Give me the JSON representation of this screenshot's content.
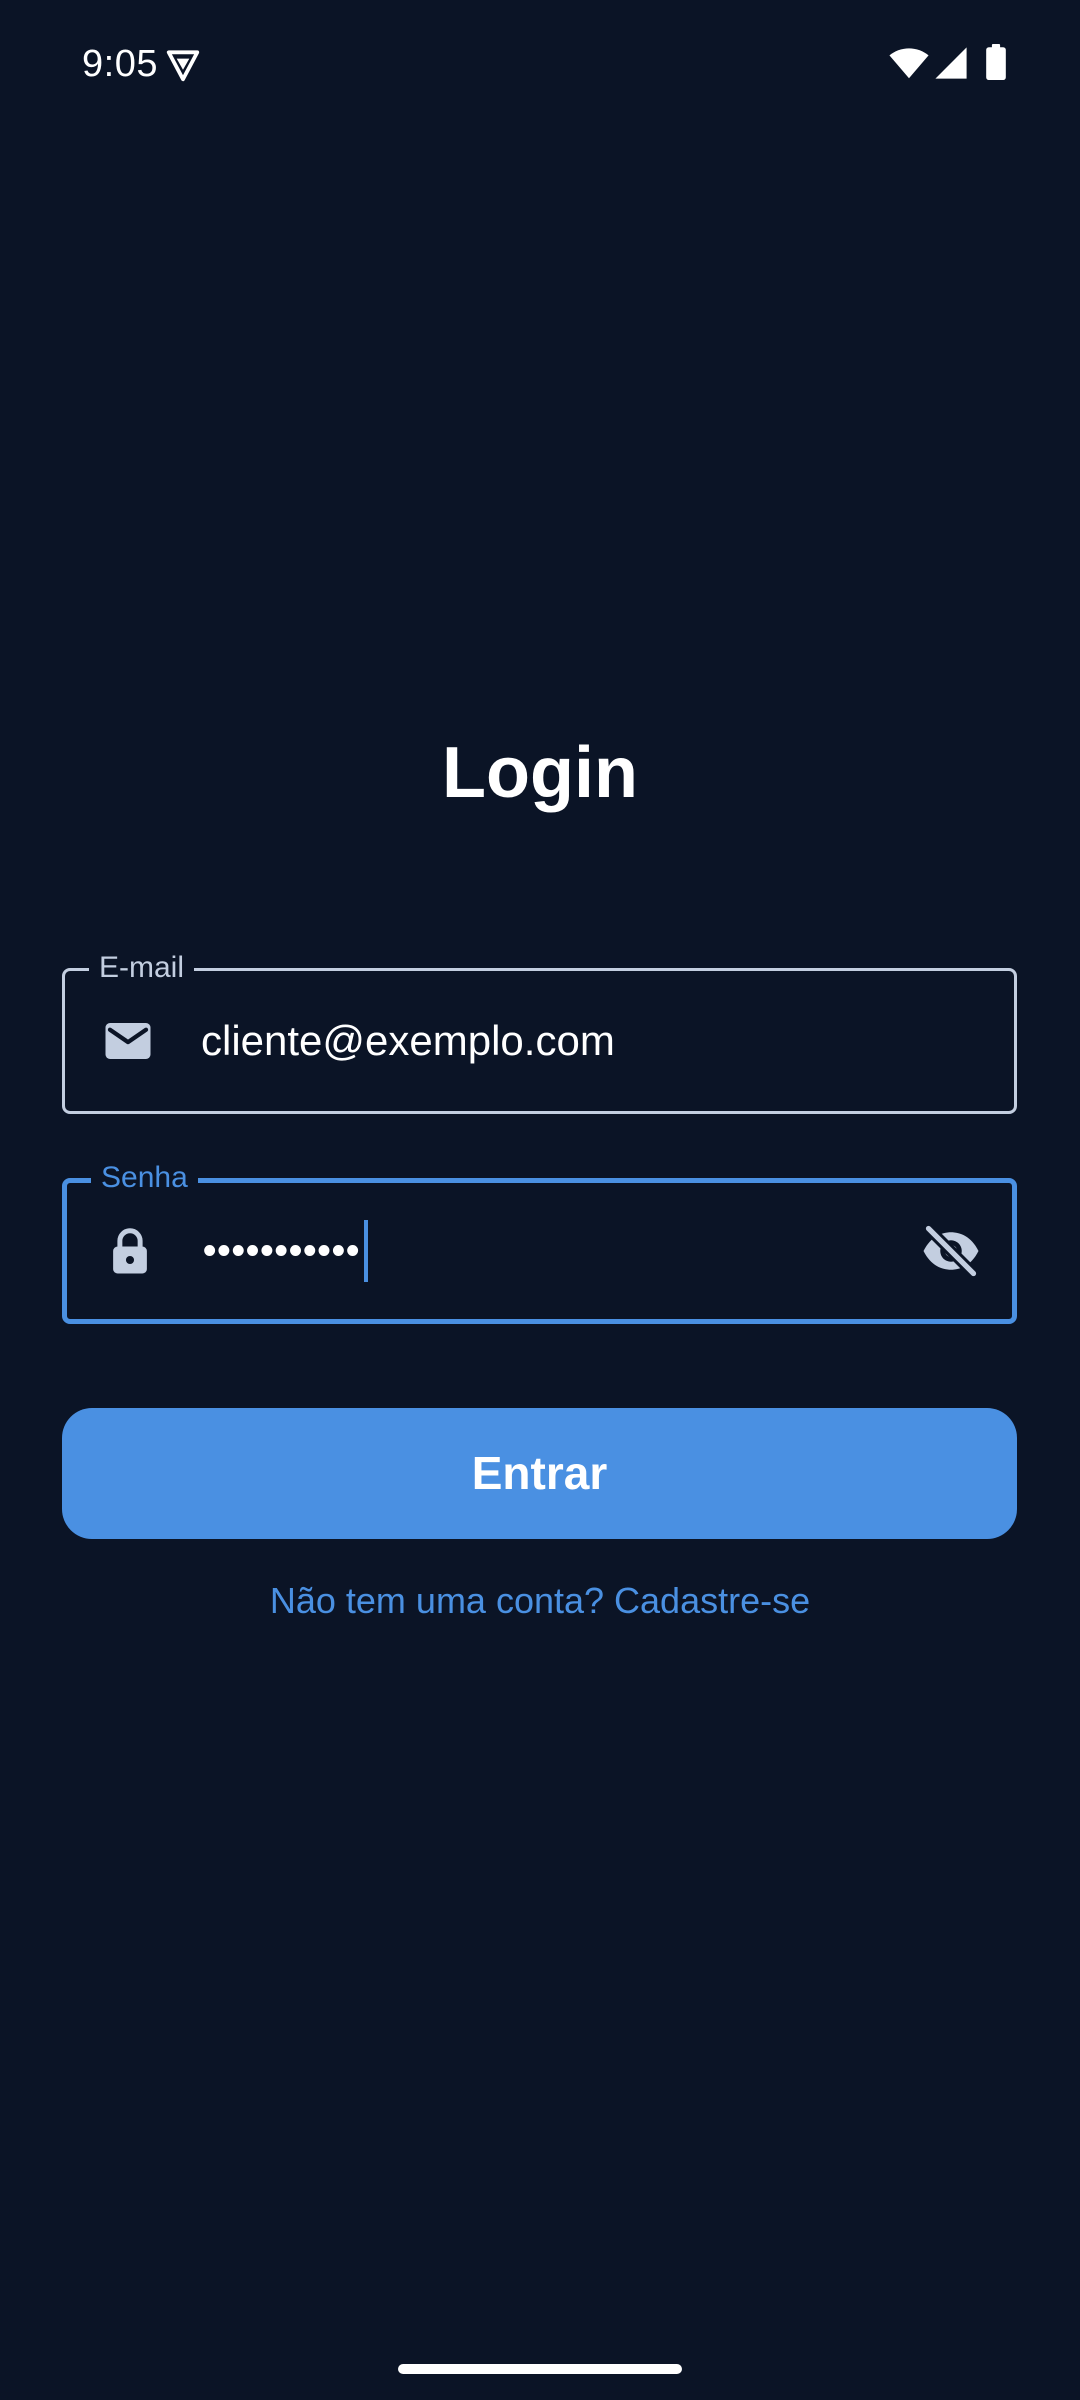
{
  "status_bar": {
    "time": "9:05",
    "icons": [
      "app-shield-icon",
      "wifi-icon",
      "cell-signal-icon",
      "battery-icon"
    ]
  },
  "login": {
    "title": "Login",
    "email": {
      "label": "E-mail",
      "value": "cliente@exemplo.com",
      "icon": "mail-icon"
    },
    "password": {
      "label": "Senha",
      "masked_value": "•••••••••••",
      "icon": "lock-icon",
      "toggle_icon": "visibility-off-icon"
    },
    "submit_label": "Entrar",
    "register_link": "Não tem uma conta? Cadastre-se"
  },
  "colors": {
    "background": "#0B1426",
    "accent": "#4A90E2",
    "outline": "#C3CEE0",
    "text": "#FFFFFF"
  }
}
